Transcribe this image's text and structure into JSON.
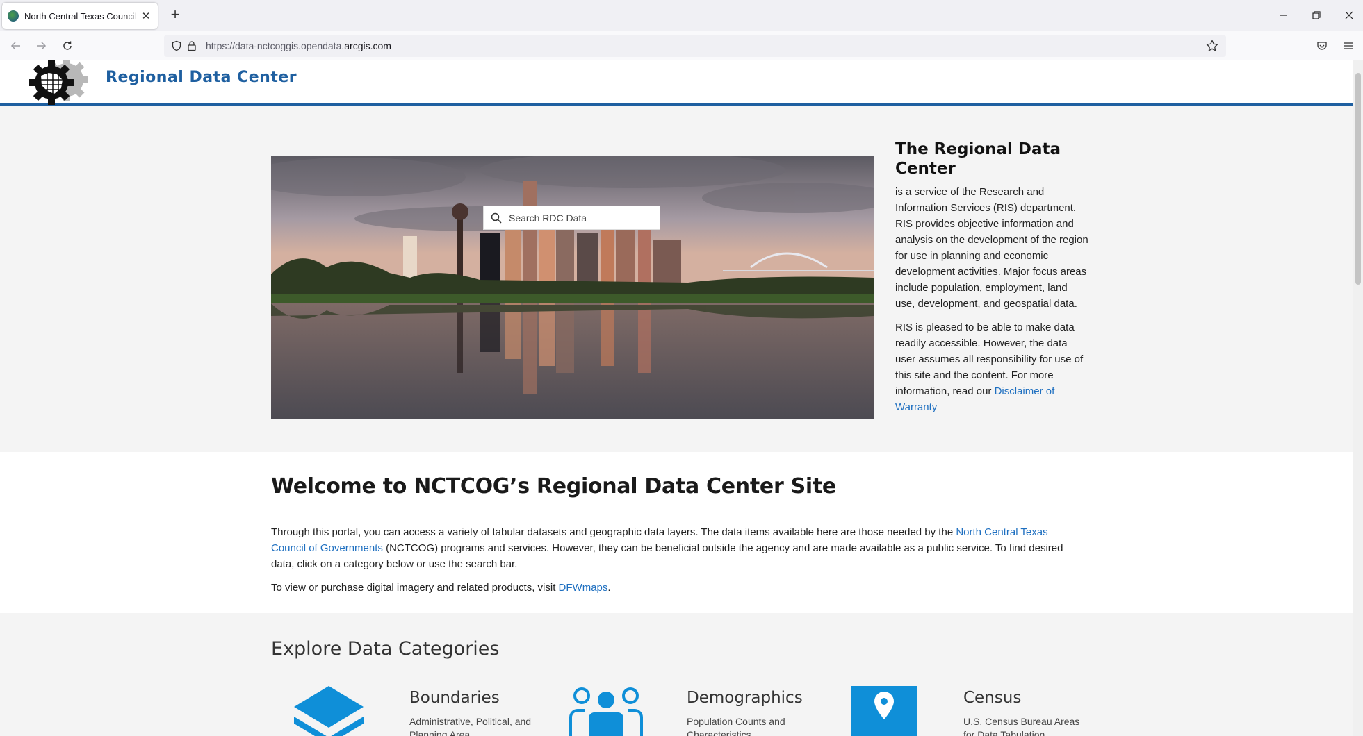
{
  "browser": {
    "tab_title": "North Central Texas Council of Governments",
    "url_prefix": "https://data-nctcoggis.opendata.",
    "url_domain": "arcgis.com"
  },
  "header": {
    "site_title": "Regional Data Center"
  },
  "hero": {
    "search_placeholder": "Search RDC Data",
    "side_title": "The Regional Data Center",
    "side_p1": "is a service of the Research and Information Services (RIS) department. RIS provides objective information and analysis on the development of the region for use in planning and economic development activities. Major focus areas include population, employment, land use, development, and geospatial data.",
    "side_p2_text": "RIS is pleased to be able to make data readily accessible. However, the data user assumes all responsibility for use of this site and the content. For more information, read our ",
    "side_p2_link": "Disclaimer of Warranty"
  },
  "welcome": {
    "title": "Welcome to NCTCOG’s Regional Data Center Site",
    "p1_before": "Through this portal, you can access a variety of tabular datasets and geographic data layers. The data items available here are those needed by the ",
    "p1_link": "North Central Texas Council of Governments",
    "p1_after": " (NCTCOG) programs and services. However, they can be beneficial outside the agency and are made available as a public service. To find desired data, click on a category below or use the search bar.",
    "p2_before": "To view or purchase digital imagery and related products, visit ",
    "p2_link": "DFWmaps",
    "p2_after": "."
  },
  "explore": {
    "title": "Explore Data Categories",
    "categories": [
      {
        "title": "Boundaries",
        "desc": "Administrative, Political, and Planning Area",
        "icon": "layers-icon"
      },
      {
        "title": "Demographics",
        "desc": "Population Counts and Characteristics",
        "icon": "people-icon"
      },
      {
        "title": "Census",
        "desc": "U.S. Census Bureau Areas for Data Tabulation",
        "icon": "map-pin-icon"
      }
    ]
  },
  "colors": {
    "brand_blue": "#1e5fa0",
    "link_blue": "#1e6fc0",
    "icon_blue": "#0f8fd8"
  }
}
